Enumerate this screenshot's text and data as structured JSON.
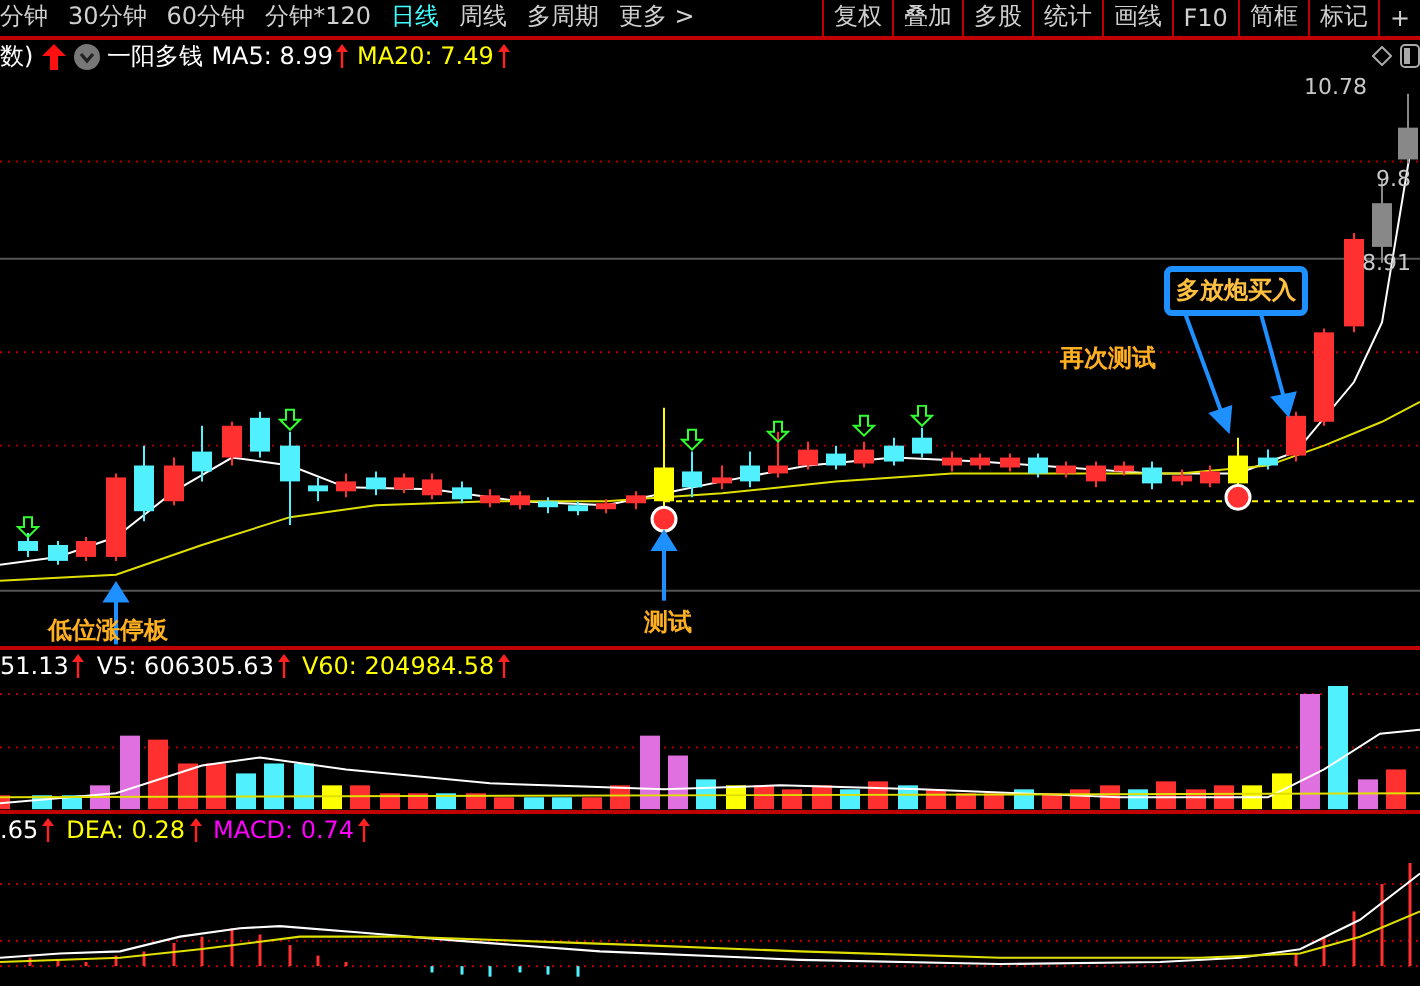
{
  "period_tabs": [
    {
      "label": "分钟",
      "selected": false
    },
    {
      "label": "30分钟",
      "selected": false
    },
    {
      "label": "60分钟",
      "selected": false
    },
    {
      "label": "分钟*120",
      "selected": false
    },
    {
      "label": "日线",
      "selected": true
    },
    {
      "label": "周线",
      "selected": false
    },
    {
      "label": "多周期",
      "selected": false
    },
    {
      "label": "更多 >",
      "selected": false
    }
  ],
  "toolbar_buttons": [
    "复权",
    "叠加",
    "多股",
    "统计",
    "画线",
    "F10",
    "简框",
    "标记",
    "+"
  ],
  "indicator_bar": {
    "prefix": "数)",
    "formula": "一阳多钱",
    "values": [
      {
        "label": "MA5: 8.99",
        "color": "#ffffff"
      },
      {
        "label": "MA20: 7.49",
        "color": "#ffff00"
      }
    ]
  },
  "price_labels": [
    "10.78",
    "9.8",
    "8.91"
  ],
  "annotations": [
    {
      "kind": "boxed",
      "text": "多放炮买入"
    },
    {
      "kind": "plain",
      "text": "再次测试"
    },
    {
      "kind": "plain",
      "text": "测试"
    },
    {
      "kind": "plain",
      "text": "低位涨停板"
    }
  ],
  "volume_header": [
    {
      "label": "51.13",
      "color": "#ffffff"
    },
    {
      "label": "V5: 606305.63",
      "color": "#ffffff"
    },
    {
      "label": "V60: 204984.58",
      "color": "#ffff00"
    }
  ],
  "macd_header": [
    {
      "label": ".65",
      "color": "#ffffff"
    },
    {
      "label": "DEA: 0.28",
      "color": "#ffff00"
    },
    {
      "label": "MACD: 0.74",
      "color": "#ff00ff"
    }
  ]
}
